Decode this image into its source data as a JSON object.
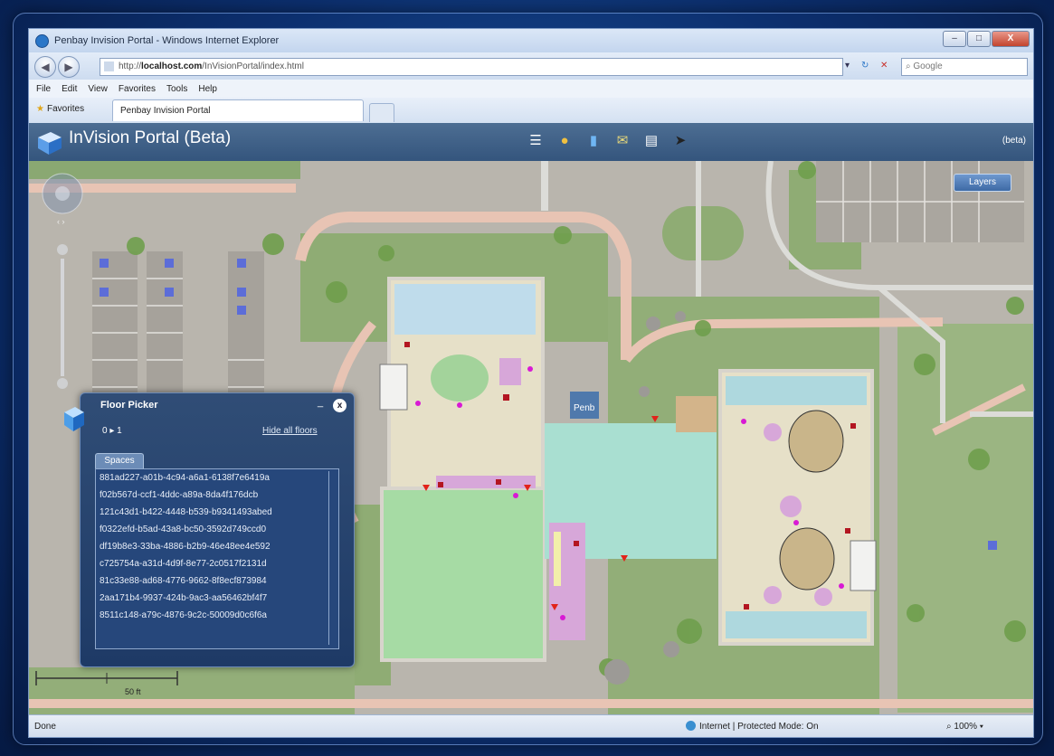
{
  "window": {
    "title": "Penbay Invision Portal - Windows Internet Explorer",
    "controls": {
      "min": "–",
      "max": "□",
      "close": "X"
    }
  },
  "navbar": {
    "address_prefix": "http://",
    "address_host": "localhost.com",
    "address_path": "/InVisionPortal/index.html",
    "search_placeholder": "Google",
    "dropdown": "▾",
    "refresh": "↻",
    "stop": "✕",
    "search_go": "⌕"
  },
  "menubar": {
    "items": [
      "File",
      "Edit",
      "View",
      "Favorites",
      "Tools",
      "Help"
    ]
  },
  "favbar": {
    "favorites_label": "Favorites",
    "tab_label": "Penbay Invision Portal"
  },
  "app": {
    "title": "InVision Portal (Beta)",
    "beta_label": "(beta)",
    "layers_button": "Layers",
    "toolbar_icons": [
      "list-icon",
      "globe-icon",
      "floor-picker-icon",
      "note-icon",
      "document-icon",
      "pointer-icon"
    ]
  },
  "floor_picker": {
    "title": "Floor Picker",
    "minimize": "_",
    "close": "x",
    "levels": "0 ▸ 1",
    "hide_all_floors": "Hide all floors",
    "tab_label": "Spaces",
    "spaces": [
      "881ad227-a01b-4c94-a6a1-6138f7e6419a",
      "f02b567d-ccf1-4ddc-a89a-8da4f176dcb",
      "121c43d1-b422-4448-b539-b9341493abed",
      "f0322efd-b5ad-43a8-bc50-3592d749ccd0",
      "df19b8e3-33ba-4886-b2b9-46e48ee4e592",
      "c725754a-a31d-4d9f-8e77-2c0517f2131d",
      "81c33e88-ad68-4776-9662-8f8ecf873984",
      "2aa171b4-9937-424b-9ac3-aa56462bf4f7",
      "8511c148-a79c-4876-9c2c-50009d0c6f6a"
    ]
  },
  "scalebar": {
    "label": "50 ft"
  },
  "map": {
    "entrance_label": "Penb"
  },
  "statusbar": {
    "left": "Done",
    "zone": "Internet | Protected Mode: On",
    "zoom": "100%"
  }
}
